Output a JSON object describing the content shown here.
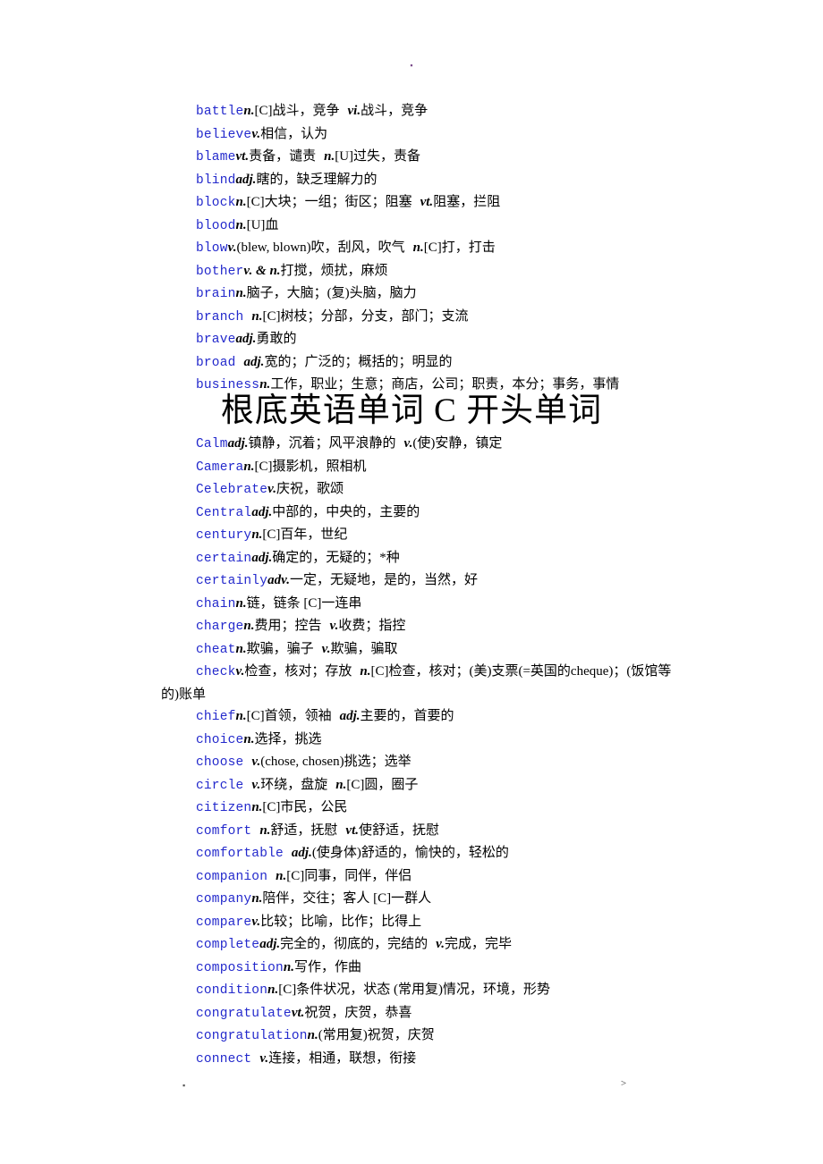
{
  "page": {
    "header_mark": "▪",
    "footer_left_mark": "▪",
    "footer_right_mark": ">"
  },
  "title": "根底英语单词 C 开头单词",
  "colors": {
    "headword": "#2329cc",
    "body_text": "#000000",
    "page_background": "#ffffff",
    "header_mark": "#7a4a8a"
  },
  "sections": [
    {
      "id": "b-words",
      "entries": [
        {
          "headword": "battle",
          "gap": false,
          "pos": "n.",
          "definition": "[C]战斗，竞争",
          "pos2": "vi.",
          "definition2": "战斗，竞争"
        },
        {
          "headword": "believe",
          "gap": false,
          "pos": "v.",
          "definition": "相信，认为"
        },
        {
          "headword": "blame",
          "gap": false,
          "pos": "vt.",
          "definition": "责备，谴责",
          "pos2": "n.",
          "definition2": "[U]过失，责备"
        },
        {
          "headword": "blind",
          "gap": false,
          "pos": "adj.",
          "definition": "瞎的，缺乏理解力的"
        },
        {
          "headword": "block",
          "gap": false,
          "pos": "n.",
          "definition": "[C]大块；一组；街区；阻塞",
          "pos2": "vt.",
          "definition2": "阻塞，拦阻"
        },
        {
          "headword": "blood",
          "gap": false,
          "pos": "n.",
          "definition": "[U]血"
        },
        {
          "headword": "blow",
          "gap": false,
          "pos": "v.",
          "definition": "(blew, blown)吹，刮风，吹气",
          "pos2": "n.",
          "definition2": "[C]打，打击"
        },
        {
          "headword": "bother",
          "gap": false,
          "pos": "v. & n.",
          "definition": "打搅，烦扰，麻烦"
        },
        {
          "headword": "brain",
          "gap": false,
          "pos": "n.",
          "definition": "脑子，大脑；(复)头脑，脑力"
        },
        {
          "headword": "branch",
          "gap": true,
          "pos": "n.",
          "definition": "[C]树枝；分部，分支，部门；支流"
        },
        {
          "headword": "brave",
          "gap": false,
          "pos": "adj.",
          "definition": "勇敢的"
        },
        {
          "headword": "broad",
          "gap": true,
          "pos": "adj.",
          "definition": "宽的；广泛的；概括的；明显的"
        },
        {
          "headword": "business",
          "gap": false,
          "pos": "n.",
          "definition": "工作，职业；生意；商店，公司；职责，本分；事务，事情"
        }
      ]
    },
    {
      "id": "c-words",
      "entries": [
        {
          "headword": "Calm",
          "gap": false,
          "pos": "adj.",
          "definition": "镇静，沉着；风平浪静的",
          "pos2": "v.",
          "definition2": "(使)安静，镇定"
        },
        {
          "headword": "Camera",
          "gap": false,
          "pos": "n.",
          "definition": "[C]摄影机，照相机"
        },
        {
          "headword": "Celebrate",
          "gap": false,
          "pos": "v.",
          "definition": "庆祝，歌颂"
        },
        {
          "headword": "Central",
          "gap": false,
          "pos": "adj.",
          "definition": "中部的，中央的，主要的"
        },
        {
          "headword": "century",
          "gap": false,
          "pos": "n.",
          "definition": "[C]百年，世纪"
        },
        {
          "headword": "certain",
          "gap": false,
          "pos": "adj.",
          "definition": "确定的，无疑的；*种"
        },
        {
          "headword": "certainly",
          "gap": false,
          "pos": "adv.",
          "definition": "一定，无疑地，是的，当然，好"
        },
        {
          "headword": "chain",
          "gap": false,
          "pos": "n.",
          "definition": "链，链条  [C]一连串"
        },
        {
          "headword": "charge",
          "gap": false,
          "pos": "n.",
          "definition": "费用；控告",
          "pos2": "v.",
          "definition2": "收费；指控"
        },
        {
          "headword": "cheat",
          "gap": false,
          "pos": "n.",
          "definition": "欺骗，骗子",
          "pos2": "v.",
          "definition2": "欺骗，骗取"
        },
        {
          "headword": "check",
          "gap": false,
          "pos": "v.",
          "definition": "检查，核对；存放",
          "pos2": "n.",
          "definition2": "[C]检查，核对；(美)支票(=英国的cheque)；(饭馆等的)账单",
          "wraps": true
        },
        {
          "headword": "chief",
          "gap": false,
          "pos": "n.",
          "definition": "[C]首领，领袖",
          "pos2": "adj.",
          "definition2": "主要的，首要的"
        },
        {
          "headword": "choice",
          "gap": false,
          "pos": "n.",
          "definition": "选择，挑选"
        },
        {
          "headword": "choose",
          "gap": true,
          "pos": "v.",
          "definition": "(chose, chosen)挑选；选举"
        },
        {
          "headword": "circle",
          "gap": true,
          "pos": "v.",
          "definition": "环绕，盘旋",
          "pos2": "n.",
          "definition2": "[C]圆，圈子"
        },
        {
          "headword": "citizen",
          "gap": false,
          "pos": "n.",
          "definition": "[C]市民，公民"
        },
        {
          "headword": "comfort",
          "gap": true,
          "pos": "n.",
          "definition": "舒适，抚慰",
          "pos2": "vt.",
          "definition2": "使舒适，抚慰"
        },
        {
          "headword": "comfortable",
          "gap": true,
          "pos": "adj.",
          "definition": "(使身体)舒适的，愉快的，轻松的"
        },
        {
          "headword": "companion",
          "gap": true,
          "pos": "n.",
          "definition": "[C]同事，同伴，伴侣"
        },
        {
          "headword": "company",
          "gap": false,
          "pos": "n.",
          "definition": "陪伴，交往；客人  [C]一群人"
        },
        {
          "headword": "compare",
          "gap": false,
          "pos": "v.",
          "definition": "比较；比喻，比作；比得上"
        },
        {
          "headword": "complete",
          "gap": false,
          "pos": "adj.",
          "definition": "完全的，彻底的，完结的",
          "pos2": "v.",
          "definition2": "完成，完毕"
        },
        {
          "headword": "composition",
          "gap": false,
          "pos": "n.",
          "definition": "写作，作曲"
        },
        {
          "headword": "condition",
          "gap": false,
          "pos": "n.",
          "definition": "[C]条件状况，状态 (常用复)情况，环境，形势"
        },
        {
          "headword": "congratulate",
          "gap": false,
          "pos": "vt.",
          "definition": "祝贺，庆贺，恭喜"
        },
        {
          "headword": "congratulation",
          "gap": false,
          "pos": "n.",
          "definition": "(常用复)祝贺，庆贺"
        },
        {
          "headword": "connect",
          "gap": true,
          "pos": "v.",
          "definition": "连接，相通，联想，衔接"
        }
      ]
    }
  ]
}
